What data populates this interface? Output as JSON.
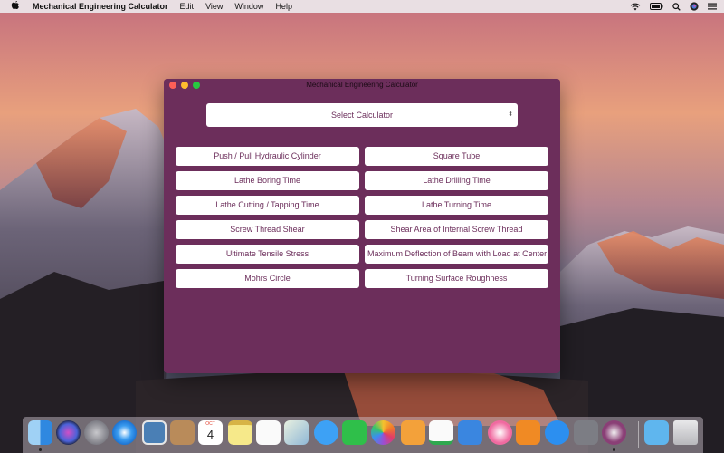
{
  "menubar": {
    "app_name": "Mechanical Engineering Calculator",
    "menus": [
      "Edit",
      "View",
      "Window",
      "Help"
    ]
  },
  "window": {
    "title": "Mechanical Engineering Calculator",
    "select_label": "Select Calculator",
    "buttons": [
      "Push / Pull Hydraulic Cylinder",
      "Square Tube",
      "Lathe Boring Time",
      "Lathe Drilling Time",
      "Lathe Cutting / Tapping Time",
      "Lathe Turning Time",
      "Screw Thread Shear",
      "Shear Area of Internal Screw Thread",
      "Ultimate Tensile Stress",
      "Maximum Deflection of Beam with Load at Center",
      "Mohrs Circle",
      "Turning Surface Roughness"
    ]
  },
  "dock": {
    "calendar_month": "OCT",
    "calendar_day": "4",
    "icons": [
      "finder-icon",
      "siri-icon",
      "launchpad-icon",
      "safari-icon",
      "photo-booth-icon",
      "contacts-icon",
      "calendar-icon",
      "notes-icon",
      "reminders-icon",
      "preview-icon",
      "messages-icon",
      "facetime-icon",
      "photos-icon",
      "pages-icon",
      "numbers-icon",
      "keynote-icon",
      "itunes-icon",
      "ibooks-icon",
      "app-store-icon",
      "system-preferences-icon",
      "mechanical-calculator-icon",
      "downloads-folder-icon",
      "trash-icon"
    ]
  },
  "colors": {
    "window_bg": "#6c2e5b",
    "button_text": "#6c2e5b",
    "button_bg": "#ffffff"
  }
}
